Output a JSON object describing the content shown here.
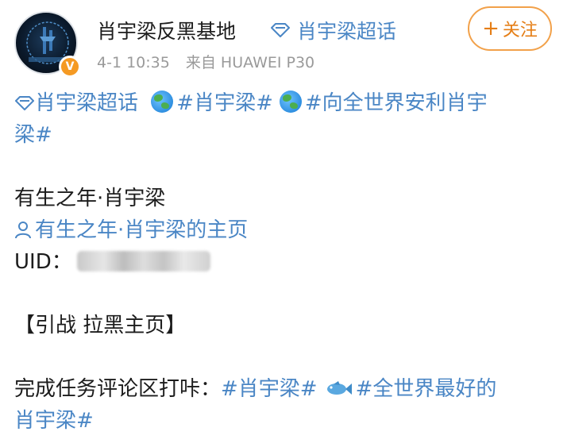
{
  "header": {
    "author_name": "肖宇梁反黑基地",
    "supertopic_label": "肖宇梁超话",
    "time": "4-1 10:35",
    "source": "来自 HUAWEI P30",
    "follow_label": "关注",
    "follow_icon": "plus-icon"
  },
  "post": {
    "line1": {
      "supertopic": "肖宇梁超话",
      "tag1": "#肖宇梁#",
      "tag2": "#向全世界安利肖宇",
      "tag2_cont": "梁#"
    },
    "name_line": "有生之年·肖宇梁",
    "homepage_link": "有生之年·肖宇梁的主页",
    "uid_label": "UID：",
    "uid_value_hidden": "blurred",
    "notice": "【引战 拉黑主页】",
    "task_prefix": "完成任务评论区打咔：",
    "task_tag1": "#肖宇梁#",
    "task_tag2": "#全世界最好的",
    "task_tag2_cont": "肖宇梁#"
  },
  "colors": {
    "link": "#4a86c5",
    "follow_accent": "#e57e16",
    "verified_badge": "#f59a23",
    "meta_text": "#9a9a9a"
  }
}
